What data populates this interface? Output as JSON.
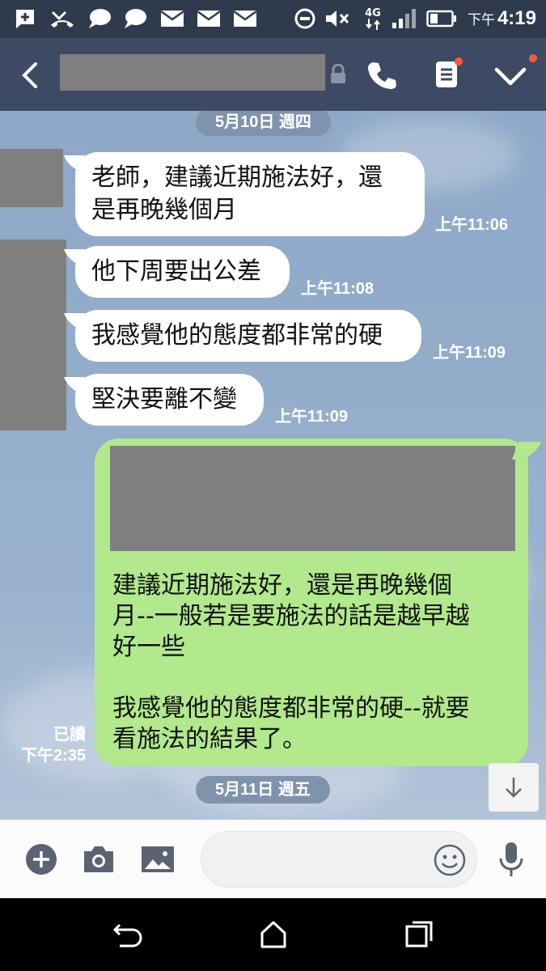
{
  "status_bar": {
    "network": "4G",
    "time_period": "下午",
    "time": "4:19"
  },
  "date_dividers": [
    "5月10日 週四",
    "5月11日 週五"
  ],
  "incoming": [
    {
      "lines": [
        "老師，建議近期施法好，還",
        "是再晚幾個月"
      ],
      "time": "上午11:06"
    },
    {
      "lines": [
        "他下周要出公差"
      ],
      "time": "上午11:08"
    },
    {
      "lines": [
        "我感覺他的態度都非常的硬"
      ],
      "time": "上午11:09"
    },
    {
      "lines": [
        "堅決要離不變"
      ],
      "time": "上午11:09"
    }
  ],
  "outgoing": {
    "text": "建議近期施法好，還是再晚幾個\n月--一般若是要施法的話是越早越\n好一些\n\n我感覺他的態度都非常的硬--就要\n看施法的結果了。",
    "read_label": "已讀",
    "time": "下午2:35"
  },
  "colors": {
    "status_bar": "#2f3a4d",
    "header": "#3d4a63",
    "outgoing_bubble": "#b1e98c",
    "incoming_bubble": "#ffffff",
    "chat_background": "#8fa9c9",
    "badge": "#ff5a3c"
  },
  "icons": {
    "header": [
      "back-icon",
      "lock-icon",
      "phone-icon",
      "notes-icon",
      "chevron-down-icon"
    ],
    "input_bar": [
      "plus-icon",
      "camera-icon",
      "image-icon",
      "emoji-icon",
      "microphone-icon"
    ],
    "nav": [
      "nav-back-icon",
      "nav-home-icon",
      "nav-recents-icon"
    ]
  }
}
